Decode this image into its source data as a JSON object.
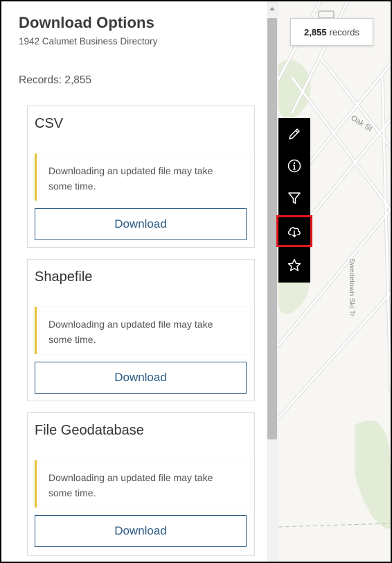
{
  "panel": {
    "title": "Download Options",
    "subtitle": "1942 Calumet Business Directory",
    "records_label": "Records: 2,855",
    "cards": [
      {
        "title": "CSV",
        "notice": "Downloading an updated file may take some time.",
        "button": "Download"
      },
      {
        "title": "Shapefile",
        "notice": "Downloading an updated file may take some time.",
        "button": "Download"
      },
      {
        "title": "File Geodatabase",
        "notice": "Downloading an updated file may take some time.",
        "button": "Download"
      }
    ]
  },
  "map": {
    "records_count": "2,855",
    "records_unit": "records",
    "street_labels": [
      "Oak St",
      "Swedetown Ski Tr"
    ]
  },
  "toolbar": {
    "tools": [
      "edit-icon",
      "info-icon",
      "filter-icon",
      "download-cloud-icon",
      "star-icon"
    ],
    "highlight_color": "#e0161c"
  },
  "colors": {
    "accent": "#2a5a83",
    "notice_bar": "#e6c235"
  }
}
